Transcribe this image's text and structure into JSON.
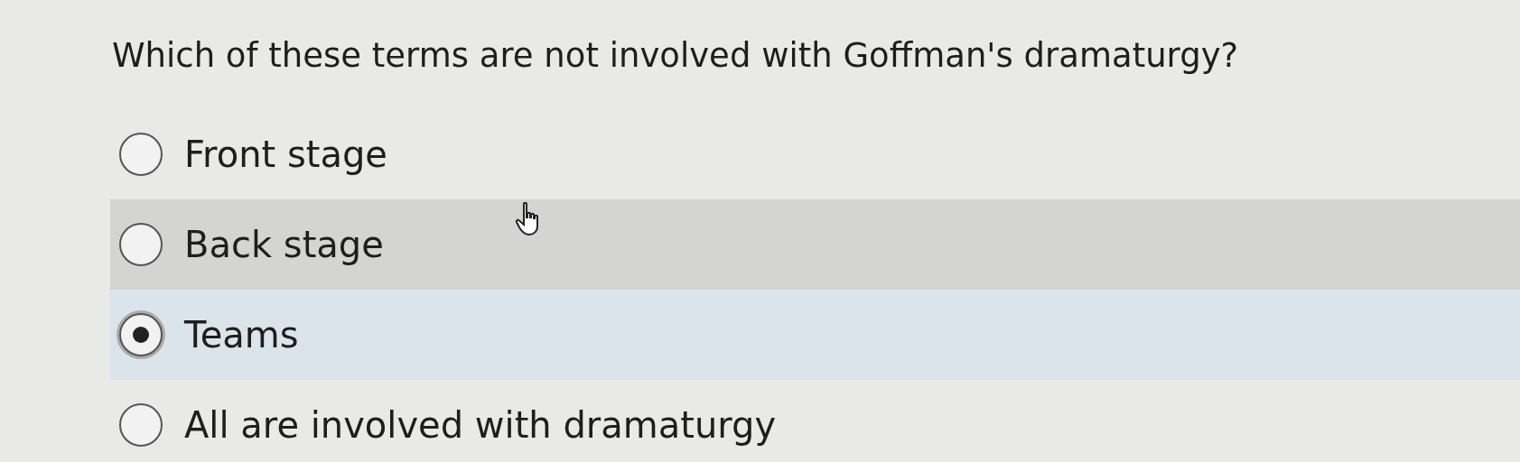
{
  "question": "Which of these terms are not involved with Goffman's dramaturgy?",
  "options": [
    {
      "label": "Front stage",
      "selected": false,
      "hovered": false
    },
    {
      "label": "Back stage",
      "selected": false,
      "hovered": true
    },
    {
      "label": "Teams",
      "selected": true,
      "hovered": false
    },
    {
      "label": "All are involved with dramaturgy",
      "selected": false,
      "hovered": false
    }
  ]
}
